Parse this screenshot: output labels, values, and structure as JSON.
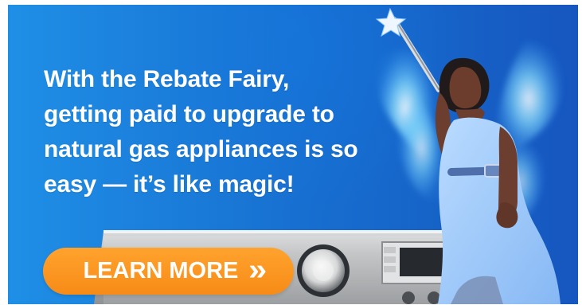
{
  "banner": {
    "headline": "With the Rebate Fairy, getting paid to upgrade to natural gas appliances is so easy — it’s like magic!",
    "cta_label": "LEARN MORE",
    "cta_arrow": "»",
    "colors": {
      "background_start": "#1f8fe6",
      "background_end": "#1656bf",
      "cta": "#f78b17",
      "text": "#ffffff"
    },
    "icons": [
      "fairy-wand",
      "fairy-wings",
      "appliance-knob",
      "appliance-display",
      "appliance-buttons"
    ]
  }
}
